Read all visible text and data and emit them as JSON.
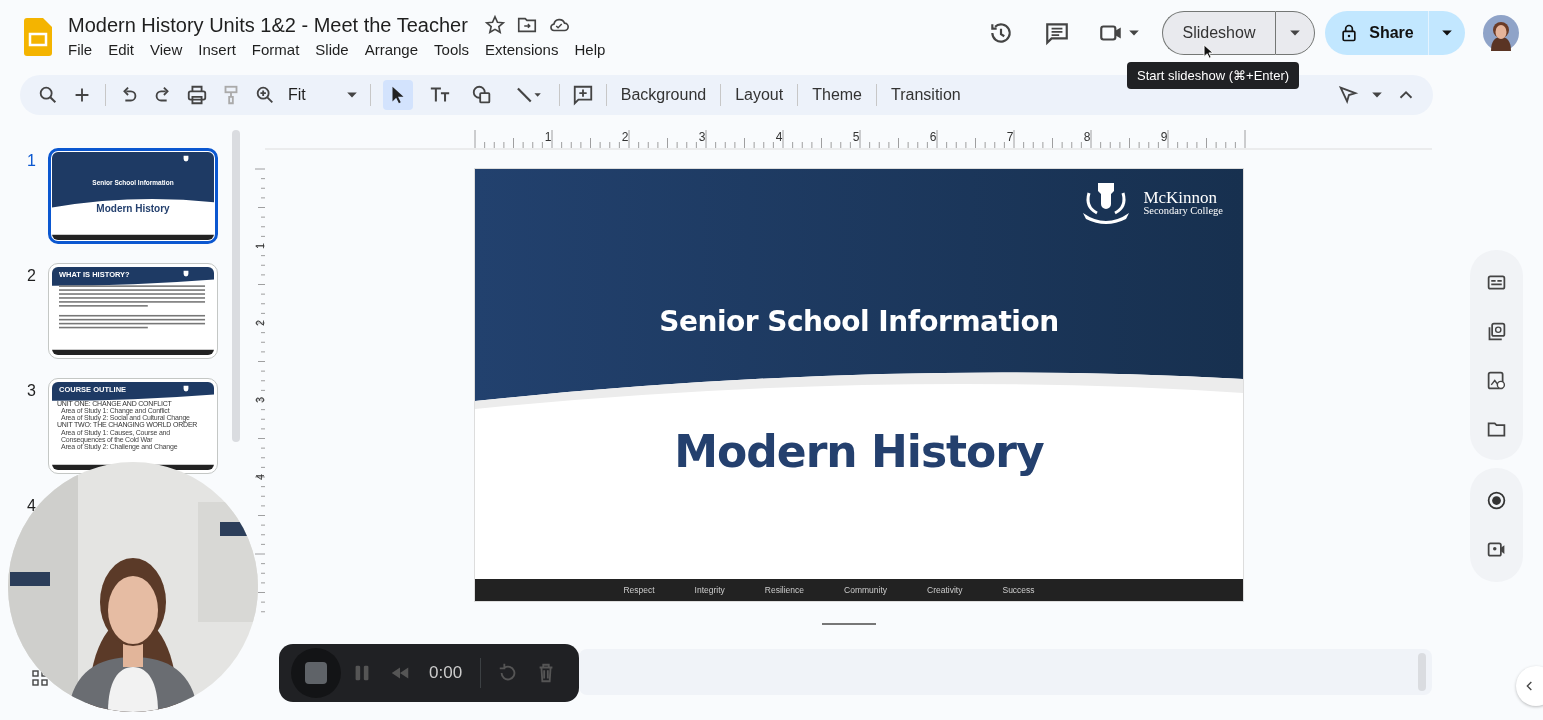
{
  "document": {
    "title": "Modern History Units 1&2 - Meet the Teacher"
  },
  "menu": [
    "File",
    "Edit",
    "View",
    "Insert",
    "Format",
    "Slide",
    "Arrange",
    "Tools",
    "Extensions",
    "Help"
  ],
  "header": {
    "slideshow": "Slideshow",
    "share": "Share",
    "tooltip": "Start slideshow (⌘+Enter)"
  },
  "toolbar": {
    "zoom": "Fit",
    "tools": [
      {
        "kind": "select",
        "selected": true
      },
      {
        "kind": "text",
        "selected": false
      },
      {
        "kind": "shape",
        "selected": false
      },
      {
        "kind": "line",
        "selected": false
      }
    ],
    "buttons": [
      "Background",
      "Layout",
      "Theme",
      "Transition"
    ]
  },
  "slides": [
    {
      "number": "1",
      "selected": true,
      "kind": "title",
      "subtitle": "Senior School Information",
      "title": "Modern History"
    },
    {
      "number": "2",
      "selected": false,
      "kind": "text",
      "heading": "WHAT IS HISTORY?"
    },
    {
      "number": "3",
      "selected": false,
      "kind": "outline",
      "heading": "COURSE OUTLINE",
      "items": [
        {
          "kind": "unit",
          "text": "UNIT ONE: CHANGE AND CONFLICT"
        },
        {
          "kind": "area",
          "text": "Area of Study 1: Change and Conflict"
        },
        {
          "kind": "area",
          "text": "Area of Study 2: Social and Cultural Change"
        },
        {
          "kind": "unit",
          "text": "UNIT TWO: THE CHANGING WORLD ORDER"
        },
        {
          "kind": "area",
          "text": "Area of Study 1: Causes, Course and Consequences of the Cold War"
        },
        {
          "kind": "area",
          "text": "Area of Study 2: Challenge and Change"
        }
      ]
    },
    {
      "number": "4",
      "selected": false,
      "kind": "covered"
    }
  ],
  "ruler": {
    "horizontal": [
      "1",
      "2",
      "3",
      "4",
      "5",
      "6",
      "7",
      "8",
      "9"
    ],
    "vertical": [
      "1",
      "2",
      "3",
      "4"
    ]
  },
  "current_slide": {
    "brand": "McKinnon",
    "brand_sub": "Secondary College",
    "subtitle": "Senior School Information",
    "title": "Modern History",
    "values": [
      "Respect",
      "Integrity",
      "Resilience",
      "Community",
      "Creativity",
      "Success"
    ]
  },
  "recorder": {
    "time": "0:00"
  }
}
